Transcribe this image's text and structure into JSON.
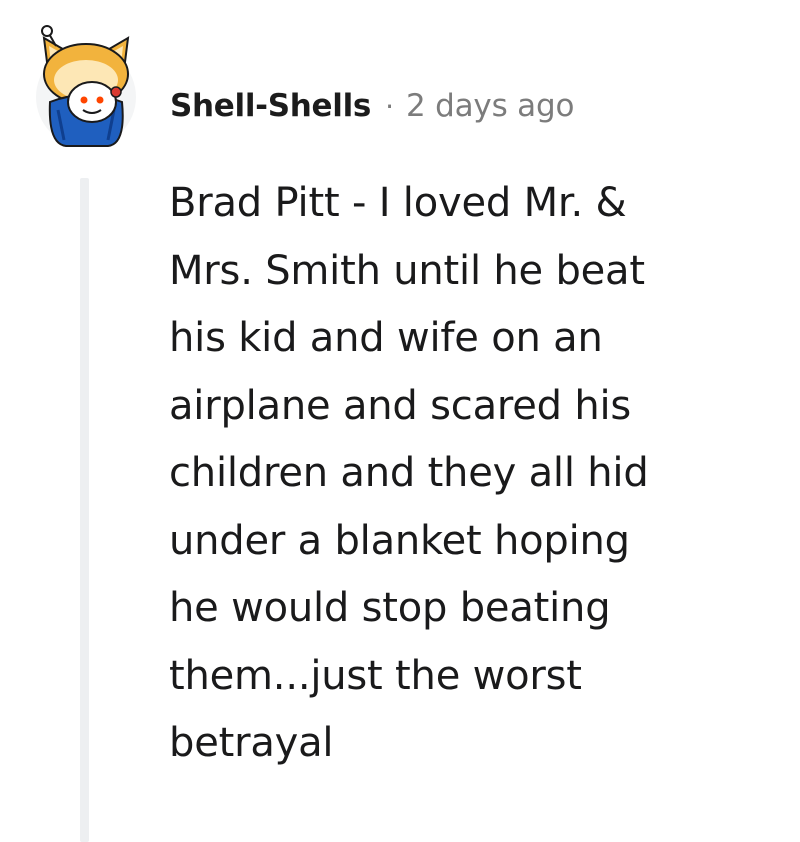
{
  "comment": {
    "author": "Shell-Shells",
    "separator": "·",
    "timestamp": "2 days ago",
    "avatar_icon": "snoo-shiba-hoodie-avatar-icon",
    "body_lines": [
      "Brad Pitt - I loved Mr. &",
      "Mrs. Smith until he beat",
      "his kid and wife on an",
      "airplane and scared his",
      "children and they all hid",
      "under a blanket hoping",
      "he would stop beating",
      "them...just the worst",
      "betrayal"
    ]
  },
  "colors": {
    "text": "#1a1a1b",
    "meta_text": "#7c7c7c",
    "thread_line": "#edeff1",
    "hoodie_blue": "#1f5fbf",
    "shiba_orange": "#f2b33d"
  }
}
